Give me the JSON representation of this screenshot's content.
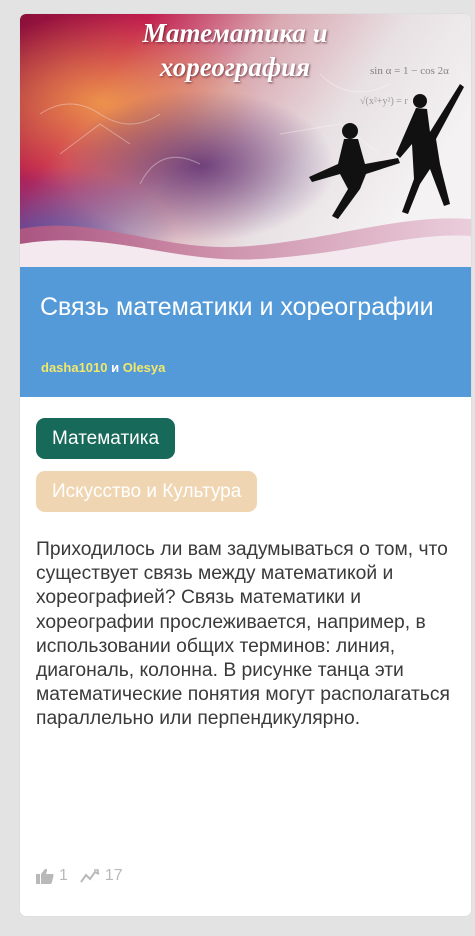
{
  "cover": {
    "title": "Математика и хореография",
    "formula_text": "sin α = 1 − cos 2α / 2"
  },
  "article": {
    "title": "Связь математики и хореографии",
    "authors": [
      "dasha1010",
      "Olesya"
    ],
    "authors_joiner": " и "
  },
  "tags": [
    "Математика",
    "Искусство и Культура"
  ],
  "description": "Приходилось ли вам задумываться о том, что существует связь между математикой и хореографией? Связь математики и хореографии прослеживается, например, в использовании общих терминов: линия, диагональ, колонна. В рисунке танца эти математические понятия могут располагаться параллельно или перпендикулярно.",
  "stats": {
    "likes": "1",
    "views": "17"
  },
  "colors": {
    "banner": "#549ad9",
    "tag_math": "#17695a",
    "tag_art": "#f0d5b2",
    "author_link": "#f2e86a"
  },
  "icons": {
    "like": "thumbs-up-icon",
    "views": "trend-line-icon"
  }
}
